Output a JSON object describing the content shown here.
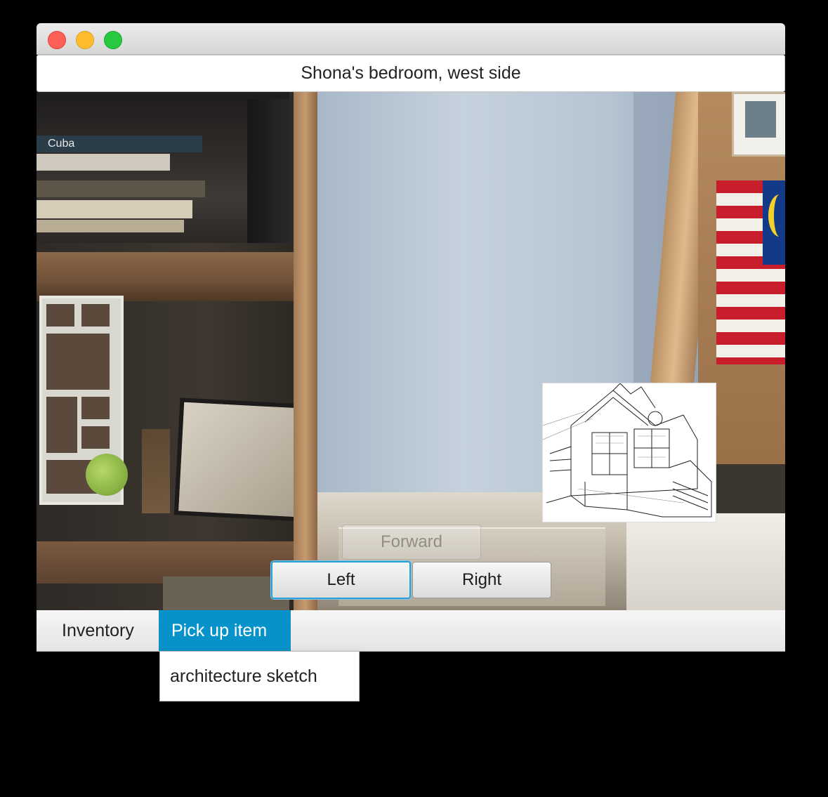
{
  "window": {
    "location_title": "Shona's bedroom, west side"
  },
  "scene": {
    "visible_item_name": "architecture sketch",
    "book_label": "Cuba"
  },
  "navigation": {
    "forward_label": "Forward",
    "left_label": "Left",
    "right_label": "Right",
    "forward_enabled": false,
    "focused": "Left"
  },
  "menubar": {
    "menus": [
      {
        "label": "Inventory"
      },
      {
        "label": "Pick up item",
        "open": true
      }
    ]
  },
  "dropdown": {
    "items": [
      {
        "label": "architecture sketch"
      }
    ]
  },
  "colors": {
    "accent": "#0892ca",
    "focus_ring": "#2a9fd6",
    "close": "#fe5f57",
    "minimize": "#febc2e",
    "maximize": "#28c840"
  }
}
